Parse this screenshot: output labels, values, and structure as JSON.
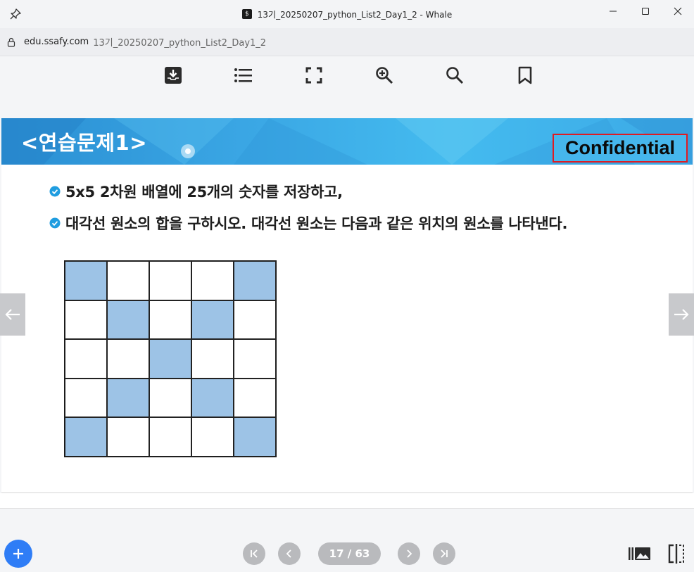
{
  "window": {
    "title": "13기_20250207_python_List2_Day1_2 - Whale",
    "favicon_glyph": "$",
    "controls": [
      "minimize-icon",
      "maximize-icon",
      "close-icon"
    ]
  },
  "address": {
    "host": "edu.ssafy.com",
    "path": "13기_20250207_python_List2_Day1_2"
  },
  "toolbar": {
    "icons": [
      "download-icon",
      "list-icon",
      "fullscreen-icon",
      "zoom-in-icon",
      "search-icon",
      "bookmark-icon"
    ]
  },
  "slide": {
    "title": "<연습문제1>",
    "badge": "Confidential",
    "bullets": [
      "5x5 2차원 배열에 25개의 숫자를 저장하고,",
      "대각선 원소의 합을 구하시오. 대각선 원소는 다음과 같은 위치의 원소를 나타낸다."
    ],
    "grid": [
      [
        1,
        0,
        0,
        0,
        1
      ],
      [
        0,
        1,
        0,
        1,
        0
      ],
      [
        0,
        0,
        1,
        0,
        0
      ],
      [
        0,
        1,
        0,
        1,
        0
      ],
      [
        1,
        0,
        0,
        0,
        1
      ]
    ],
    "colors": {
      "highlight": "#9dc3e6",
      "header": "#3aa6e4",
      "badge_border": "#e01b22"
    }
  },
  "pager": {
    "current_label": "17 / 63",
    "current": 17,
    "total": 63
  },
  "colors": {
    "fab": "#2f7df6",
    "pager_bg": "#b9babd"
  }
}
